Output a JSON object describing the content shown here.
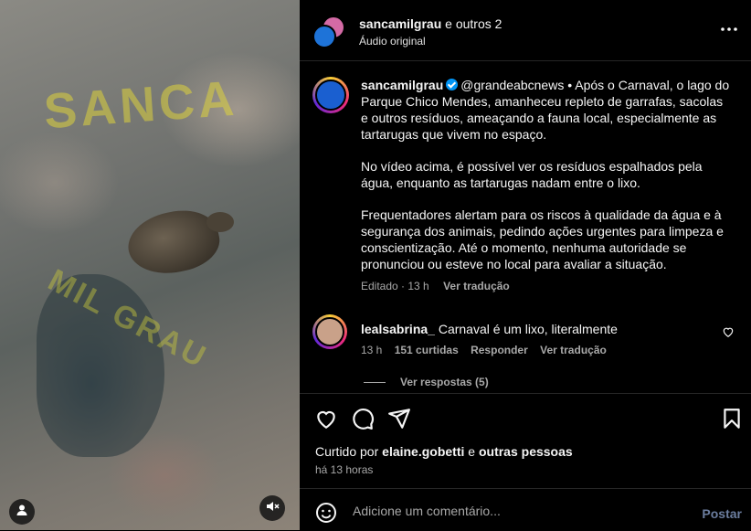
{
  "media": {
    "watermark_top": "SANCA",
    "watermark_bottom": "MIL GRAU"
  },
  "header": {
    "username": "sancamilgrau",
    "others": "e outros 2",
    "audio": "Áudio original"
  },
  "caption": {
    "username": "sancamilgrau",
    "mention": "@grandeabcnews",
    "paragraph1": " • Após o Carnaval, o lago do Parque Chico Mendes, amanheceu repleto de garrafas, sacolas e outros resíduos, ameaçando a fauna local, especialmente as tartarugas que vivem no espaço.",
    "paragraph2": "No vídeo acima, é possível ver os resíduos espalhados pela água, enquanto as tartarugas nadam entre o lixo.",
    "paragraph3": "Frequentadores alertam para os riscos à qualidade da água e à segurança dos animais, pedindo ações urgentes para limpeza e conscientização. Até o momento, nenhuma autoridade se pronunciou ou esteve no local para avaliar a situação.",
    "meta_edited": "Editado · 13 h",
    "meta_translate": "Ver tradução"
  },
  "comment": {
    "username": "lealsabrina_",
    "text": "Carnaval é um lixo, literalmente",
    "time": "13 h",
    "likes": "151 curtidas",
    "reply": "Responder",
    "translate": "Ver tradução",
    "view_replies": "Ver respostas (5)"
  },
  "actions": {
    "liked_prefix": "Curtido por ",
    "liked_user": "elaine.gobetti",
    "liked_mid": " e ",
    "liked_rest": "outras pessoas",
    "time": "há 13 horas"
  },
  "add_comment": {
    "placeholder": "Adicione um comentário...",
    "post": "Postar"
  }
}
